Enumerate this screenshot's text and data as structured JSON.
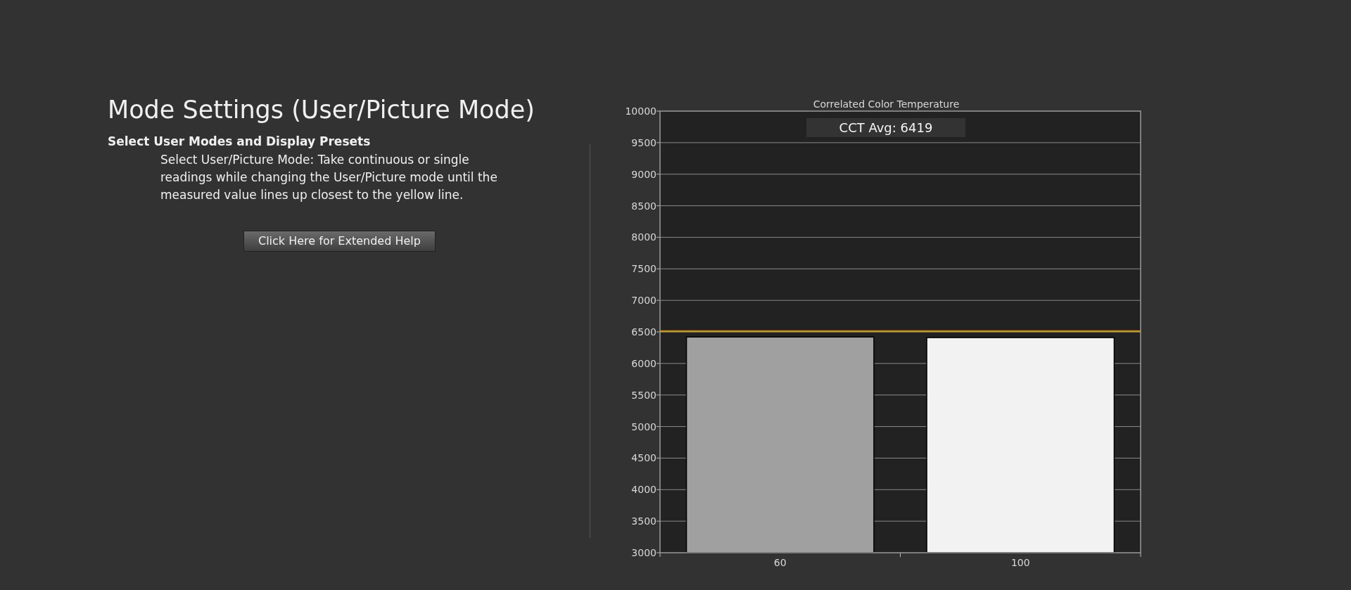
{
  "help": {
    "title": "Mode Settings (User/Picture Mode)",
    "subtitle": "Select User Modes and Display Presets",
    "description": "Select User/Picture Mode: Take continuous or single readings while changing the User/Picture mode until the measured value lines up closest to the yellow line.",
    "button": "Click Here for Extended Help"
  },
  "chart": {
    "chart_data": {
      "type": "bar",
      "title": "Correlated Color Temperature",
      "categories": [
        "60",
        "100"
      ],
      "series": [
        {
          "color": "#a0a0a0",
          "values": [
            6420,
            null
          ]
        },
        {
          "color": "#f2f2f2",
          "values": [
            null,
            6410
          ]
        }
      ],
      "ylim": [
        3000,
        10000
      ],
      "yticks": [
        3000,
        3500,
        4000,
        4500,
        5000,
        5500,
        6000,
        6500,
        7000,
        7500,
        8000,
        8500,
        9000,
        9500,
        10000
      ],
      "grid": true,
      "ref_lines": [
        {
          "value": 6510,
          "axis": "y",
          "color": "#c8961e"
        }
      ],
      "annotations": [
        {
          "text": "CCT Avg: 6419"
        }
      ]
    }
  }
}
